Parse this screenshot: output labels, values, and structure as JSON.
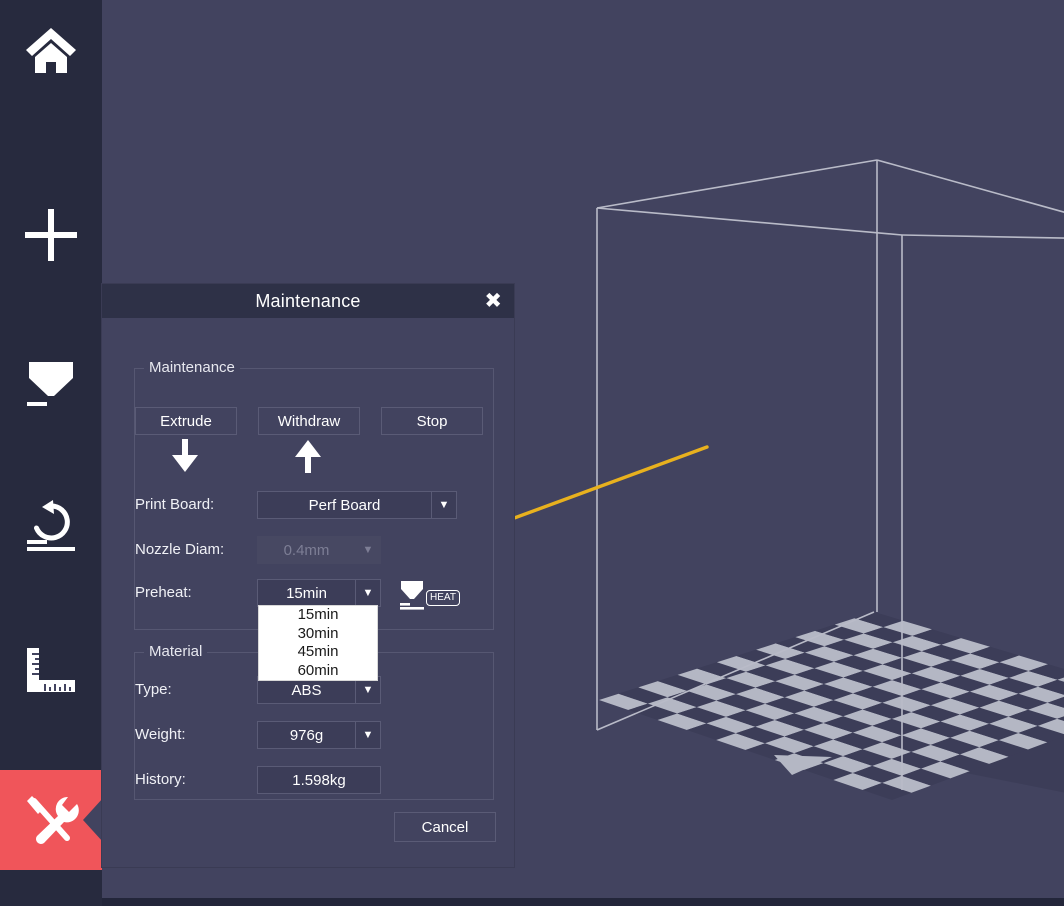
{
  "app": {
    "sidebar": {
      "items": [
        {
          "name": "home",
          "icon": "home-icon",
          "active": false
        },
        {
          "name": "add",
          "icon": "plus-icon",
          "active": false
        },
        {
          "name": "print",
          "icon": "nozzle-print-icon",
          "active": false
        },
        {
          "name": "rotate",
          "icon": "rotate-ccw-icon",
          "active": false
        },
        {
          "name": "measure",
          "icon": "ruler-icon",
          "active": false
        },
        {
          "name": "maintenance",
          "icon": "tools-icon",
          "active": true
        }
      ]
    },
    "colors": {
      "sidebar_bg": "#272a3e",
      "viewport_bg": "#42435f",
      "accent_active": "#f0555a",
      "dialog_bg": "#42435f",
      "titlebar_bg": "#2e3147",
      "annotation_arrow": "#e8b11e",
      "plate_light": "#b4b7c4",
      "plate_dark": "#3c3d58",
      "wireframe": "#b9bbc8"
    }
  },
  "dialog": {
    "title": "Maintenance",
    "close_label": "✖",
    "maintenance_group": {
      "legend": "Maintenance",
      "buttons": [
        {
          "label": "Extrude",
          "glyph": "↓"
        },
        {
          "label": "Withdraw",
          "glyph": "↑"
        },
        {
          "label": "Stop",
          "glyph": ""
        }
      ],
      "fields": [
        {
          "label": "Print Board:",
          "control": "combo",
          "value": "Perf Board",
          "enabled": true,
          "arrow": "▼"
        },
        {
          "label": "Nozzle Diam:",
          "control": "combo",
          "value": "0.4mm",
          "enabled": false,
          "arrow": "▼"
        },
        {
          "label": "Preheat:",
          "control": "combo",
          "value": "15min",
          "enabled": true,
          "arrow": "▼",
          "open": true,
          "options": [
            "15min",
            "30min",
            "45min",
            "60min"
          ]
        }
      ],
      "heat_button": {
        "label": "HEAT",
        "icon": "nozzle-heat-icon"
      }
    },
    "material_group": {
      "legend": "Material",
      "fields": [
        {
          "label": "Type:",
          "control": "combo",
          "value": "ABS",
          "arrow": "▼"
        },
        {
          "label": "Weight:",
          "control": "combo",
          "value": "976g",
          "arrow": "▼"
        },
        {
          "label": "History:",
          "control": "textfield",
          "value": "1.598kg",
          "arrow": ""
        }
      ]
    },
    "footer": {
      "cancel_label": "Cancel"
    }
  }
}
